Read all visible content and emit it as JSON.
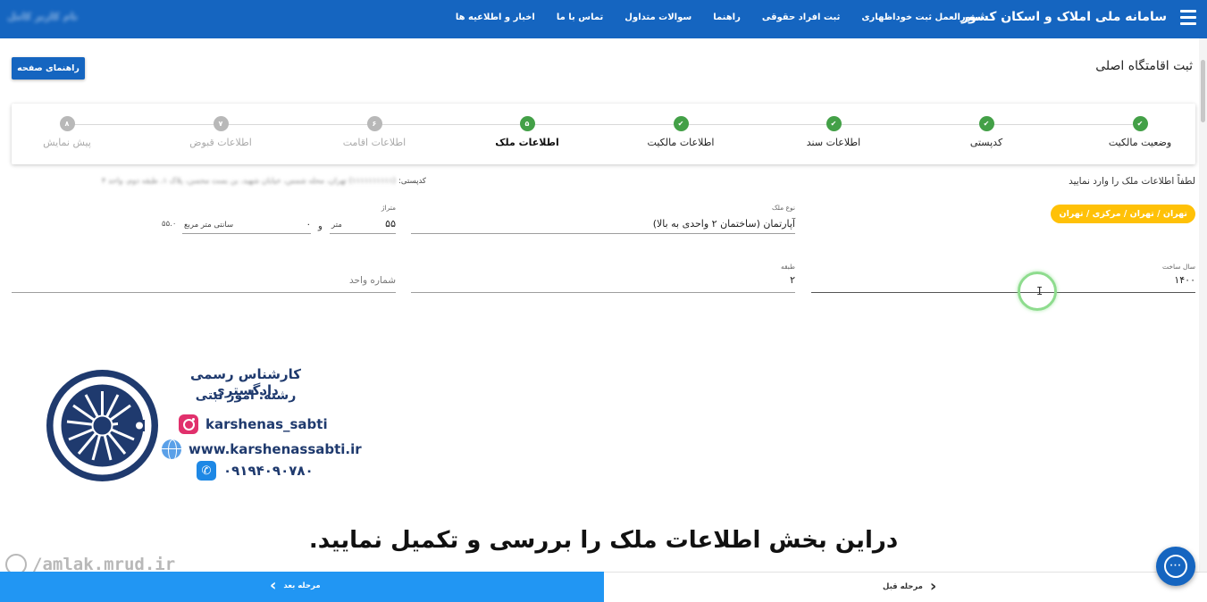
{
  "header": {
    "brand": "سامانه ملی املاک و اسکان کشور",
    "nav": [
      "اخبار و اطلاعیه ها",
      "تماس با ما",
      "سوالات متداول",
      "راهنما",
      "ثبت افراد حقوقی",
      "دستورالعمل ثبت خوداظهاری"
    ],
    "user": "نام کاربر کامل"
  },
  "page": {
    "title": "ثبت اقامتگاه اصلی",
    "help_button": "راهنمای صفحه"
  },
  "stepper": {
    "steps": [
      {
        "label": "وضعیت مالکیت",
        "state": "done",
        "badge": ""
      },
      {
        "label": "کدپستی",
        "state": "done",
        "badge": ""
      },
      {
        "label": "اطلاعات سند",
        "state": "done",
        "badge": ""
      },
      {
        "label": "اطلاعات مالکیت",
        "state": "done",
        "badge": ""
      },
      {
        "label": "اطلاعات ملک",
        "state": "active",
        "badge": "۵"
      },
      {
        "label": "اطلاعات اقامت",
        "state": "todo",
        "badge": "۶"
      },
      {
        "label": "اطلاعات قبوض",
        "state": "todo",
        "badge": "۷"
      },
      {
        "label": "پیش نمایش",
        "state": "todo",
        "badge": "۸"
      }
    ]
  },
  "form": {
    "prompt": "لطفاً اطلاعات ملک را وارد نمایید",
    "postal_label": "کدپستی:",
    "postal_value": "(۱۱۱۱۱۱۱۱۱۱) تهران، محله شمس، خیابان شهید، بن بست محسن، پلاک ۱، طبقه دوم، واحد ۴",
    "location_chip": "تهران / تهران / مرکزی / تهران",
    "property_type": {
      "label": "نوع ملک",
      "value": "آپارتمان (ساختمان ۲ واحدی به بالا)"
    },
    "area_m": {
      "label": "متراژ",
      "value": "۵۵",
      "unit": "متر"
    },
    "area_and": "و",
    "area_cm": {
      "value": "۰",
      "unit": "سانتی متر مربع"
    },
    "area_total": "۵۵.۰",
    "build_year": {
      "label": "سال ساخت",
      "value": "۱۴۰۰"
    },
    "floor": {
      "label": "طبقه",
      "value": "۲"
    },
    "unit_no": {
      "placeholder": "شماره واحد"
    }
  },
  "overlay": {
    "title": "کارشناس رسمی دادگستری",
    "subtitle": "رشته: امور ثبتی",
    "instagram": "karshenas_sabti",
    "website": "www.karshenassabti.ir",
    "phone": "۰۹۱۹۴۰۹۰۷۸۰"
  },
  "caption": "دراین بخش اطلاعات ملک را بررسی و تکمیل نمایید.",
  "watermark": "/amlak.mrud.ir",
  "footer": {
    "next": "مرحله بعد",
    "prev": "مرحله قبل"
  },
  "colors": {
    "primary": "#1565c0",
    "success": "#43a047",
    "chip": "#ffc107",
    "next_button": "#2196f3"
  }
}
